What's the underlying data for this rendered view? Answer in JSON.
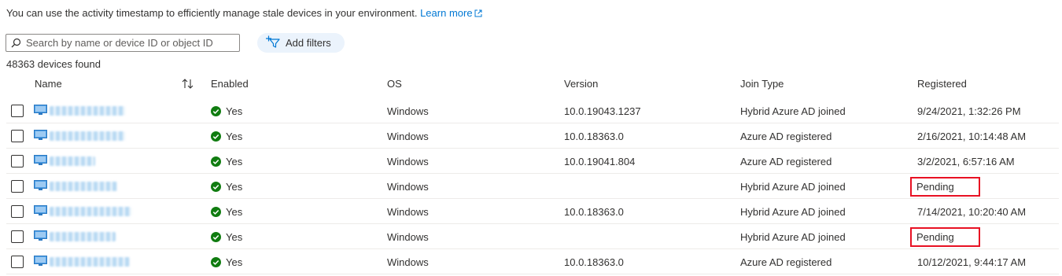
{
  "intro": {
    "text": "You can use the activity timestamp to efficiently manage stale devices in your environment.",
    "link": "Learn more"
  },
  "search": {
    "placeholder": "Search by name or device ID or object ID"
  },
  "filters": {
    "label": "Add filters"
  },
  "results_count": "48363 devices found",
  "columns": {
    "name": "Name",
    "enabled": "Enabled",
    "os": "OS",
    "version": "Version",
    "join_type": "Join Type",
    "registered": "Registered"
  },
  "rows": [
    {
      "enabled": "Yes",
      "os": "Windows",
      "version": "10.0.19043.1237",
      "join_type": "Hybrid Azure AD joined",
      "registered": "9/24/2021, 1:32:26 PM"
    },
    {
      "enabled": "Yes",
      "os": "Windows",
      "version": "10.0.18363.0",
      "join_type": "Azure AD registered",
      "registered": "2/16/2021, 10:14:48 AM"
    },
    {
      "enabled": "Yes",
      "os": "Windows",
      "version": "10.0.19041.804",
      "join_type": "Azure AD registered",
      "registered": "3/2/2021, 6:57:16 AM"
    },
    {
      "enabled": "Yes",
      "os": "Windows",
      "version": "",
      "join_type": "Hybrid Azure AD joined",
      "registered": "Pending"
    },
    {
      "enabled": "Yes",
      "os": "Windows",
      "version": "10.0.18363.0",
      "join_type": "Hybrid Azure AD joined",
      "registered": "7/14/2021, 10:20:40 AM"
    },
    {
      "enabled": "Yes",
      "os": "Windows",
      "version": "",
      "join_type": "Hybrid Azure AD joined",
      "registered": "Pending"
    },
    {
      "enabled": "Yes",
      "os": "Windows",
      "version": "10.0.18363.0",
      "join_type": "Azure AD registered",
      "registered": "10/12/2021, 9:44:17 AM"
    }
  ],
  "colors": {
    "accent": "#0078d4",
    "success": "#107c10",
    "highlight": "#e81123",
    "filter_bg": "#ebf3fc"
  },
  "icons": [
    "external-link-icon",
    "search-icon",
    "add-filter-icon",
    "sort-icon",
    "device-icon",
    "check-circle-icon"
  ]
}
